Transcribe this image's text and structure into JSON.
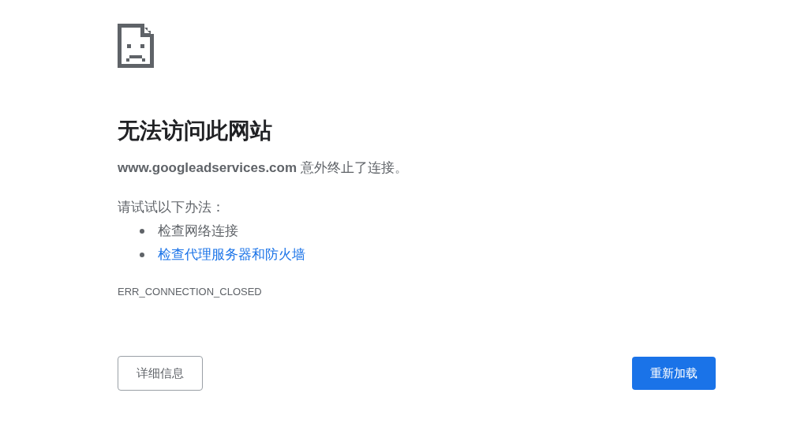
{
  "title": "无法访问此网站",
  "description": "**www.googleadservices.com** 意外终止了连接。",
  "suggestions_heading": "请试试以下办法：",
  "suggestions": [
    {
      "kind": "text",
      "text": "检查网络连接"
    },
    {
      "kind": "link",
      "text": "检查代理服务器和防火墙"
    }
  ],
  "error_code": "ERR_CONNECTION_CLOSED",
  "buttons": {
    "details": "详细信息",
    "reload": "重新加载"
  }
}
